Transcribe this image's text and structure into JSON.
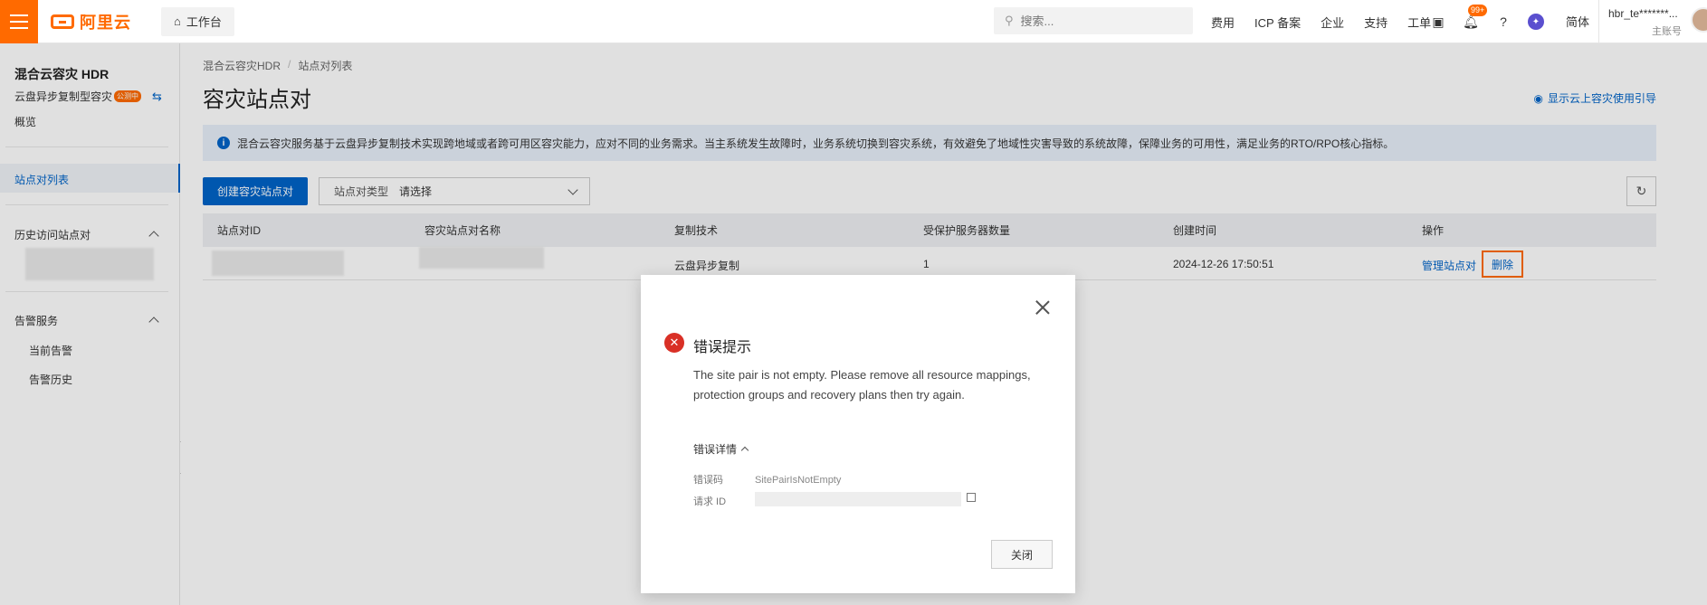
{
  "topbar": {
    "logo_text": "阿里云",
    "workbench": "工作台",
    "search_placeholder": "搜索...",
    "links": [
      "费用",
      "ICP 备案",
      "企业",
      "支持",
      "工单"
    ],
    "notification_badge": "99+",
    "language": "简体",
    "user_name": "hbr_te*******...",
    "user_role": "主账号"
  },
  "sidebar": {
    "title": "混合云容灾 HDR",
    "subtitle": "云盘异步复制型容灾",
    "subtitle_tag": "公测中",
    "overview": "概览",
    "active_item": "站点对列表",
    "history_section": "历史访问站点对",
    "alarm_section": "告警服务",
    "alarm_items": [
      "当前告警",
      "告警历史"
    ]
  },
  "main": {
    "breadcrumb": [
      "混合云容灾HDR",
      "站点对列表"
    ],
    "title": "容灾站点对",
    "guide_link": "显示云上容灾使用引导",
    "notice": "混合云容灾服务基于云盘异步复制技术实现跨地域或者跨可用区容灾能力，应对不同的业务需求。当主系统发生故障时，业务系统切换到容灾系统，有效避免了地域性灾害导致的系统故障，保障业务的可用性，满足业务的RTO/RPO核心指标。",
    "create_button": "创建容灾站点对",
    "filter_label": "站点对类型",
    "filter_placeholder": "请选择",
    "table": {
      "columns": [
        "站点对ID",
        "容灾站点对名称",
        "复制技术",
        "受保护服务器数量",
        "创建时间",
        "操作"
      ],
      "rows": [
        {
          "replication": "云盘异步复制",
          "protected_count": "1",
          "created": "2024-12-26 17:50:51",
          "action_manage": "管理站点对",
          "action_delete": "删除"
        }
      ]
    }
  },
  "modal": {
    "title": "错误提示",
    "message": "The site pair is not empty. Please remove all resource mappings, protection groups and recovery plans then try again.",
    "details_toggle": "错误详情",
    "error_code_label": "错误码",
    "error_code": "SitePairIsNotEmpty",
    "request_id_label": "请求 ID",
    "close_button": "关闭"
  }
}
